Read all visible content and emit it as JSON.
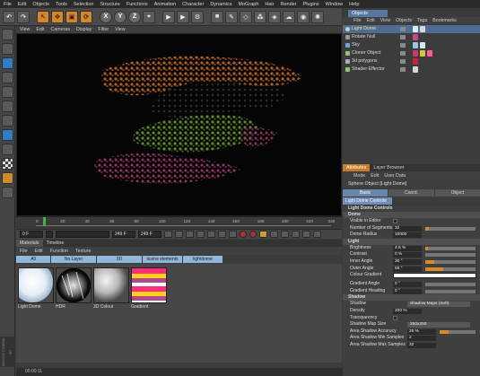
{
  "menubar": [
    "File",
    "Edit",
    "Objects",
    "Tools",
    "Selection",
    "Structure",
    "Functions",
    "Animation",
    "Character",
    "Dynamics",
    "MoGraph",
    "Hair",
    "Render",
    "Plugins",
    "Window",
    "Help"
  ],
  "toolbar": {
    "xyz": [
      "X",
      "Y",
      "Z"
    ]
  },
  "viewport": {
    "menu": [
      "View",
      "Edit",
      "Cameras",
      "Display",
      "Filter",
      "View"
    ]
  },
  "timeline": {
    "ticks": [
      "0",
      "20",
      "40",
      "60",
      "80",
      "100",
      "120",
      "140",
      "160",
      "180",
      "200",
      "220",
      "240"
    ],
    "start_field": "0 F",
    "end_field": "249 F",
    "current_field": "0 F",
    "max_field": "249 F",
    "frame_readout": "0 F"
  },
  "materials": {
    "tabs": [
      "Materials",
      "Timeline"
    ],
    "menu": [
      "File",
      "Edit",
      "Function",
      "Texture"
    ],
    "layers": [
      "All",
      "No Layer",
      "3D",
      "scene elements",
      "lightdome"
    ],
    "items": [
      {
        "name": "Light Dome"
      },
      {
        "name": "HDR"
      },
      {
        "name": "3D Colour"
      },
      {
        "name": "Gradient"
      }
    ]
  },
  "statusbar": {
    "time": "00:00:11"
  },
  "logo_text": "MAXON CINEMA 4D",
  "objects": {
    "tab": "Objects",
    "menu": [
      "File",
      "Edit",
      "View",
      "Objects",
      "Tags",
      "Bookmarks"
    ],
    "rows": [
      {
        "name": "Light Dome",
        "selected": true
      },
      {
        "name": "Rotate Null",
        "selected": false
      },
      {
        "name": "Sky",
        "selected": false
      },
      {
        "name": "Cloner Object",
        "selected": false
      },
      {
        "name": "3d polygons",
        "selected": false
      },
      {
        "name": "Shader Effector",
        "selected": false
      }
    ]
  },
  "attributes": {
    "tabs": [
      "Attributes",
      "Layer Browser"
    ],
    "menu": [
      "Mode",
      "Edit",
      "User Data"
    ],
    "title": "Sphere Object [Light Dome]",
    "subtabs": [
      "Basic",
      "Coord.",
      "Object"
    ],
    "selected_tab": "Light Dome Controls",
    "section_header": "Light Dome Controls",
    "dome_section": "Dome",
    "visible_in_editor": "Visible in Editor",
    "segments_label": "Number of Segments",
    "segments_value": "32",
    "radius_label": "Dome Radius",
    "radius_value": "10000",
    "light_section": "Light",
    "brightness_label": "Brightness",
    "brightness_value": "4.5 %",
    "contrast_label": "Contrast",
    "contrast_value": "0 %",
    "inner_label": "Inner Angle",
    "inner_value": "30 °",
    "outer_label": "Outer Angle",
    "outer_value": "65 °",
    "colour_gradient_label": "Colour Gradient",
    "gradient_angle_label": "Gradient Angle",
    "gradient_angle_value": "0 °",
    "gradient_heading_label": "Gradient Heading",
    "gradient_heading_value": "0 °",
    "shadow_section": "Shadow",
    "shadow_label": "Shadow",
    "shadow_value": "Shadow Maps (Soft)",
    "density_label": "Density",
    "density_value": "200 %",
    "transparency_label": "Transparency",
    "map_size_label": "Shadow Map Size",
    "map_size_value": "250x250",
    "area_accuracy_label": "Area Shadow Accuracy",
    "area_accuracy_value": "25 %",
    "min_samples_label": "Area Shadow Min Samples",
    "min_samples_value": "2",
    "max_samples_label": "Area Shadow Max Samples",
    "max_samples_value": "32"
  },
  "colors": {
    "accent_orange": "#d6862a",
    "selection_blue": "#4e6d92",
    "selected_text": "#ffe27a",
    "layer_blue": "#8eb7d9"
  }
}
